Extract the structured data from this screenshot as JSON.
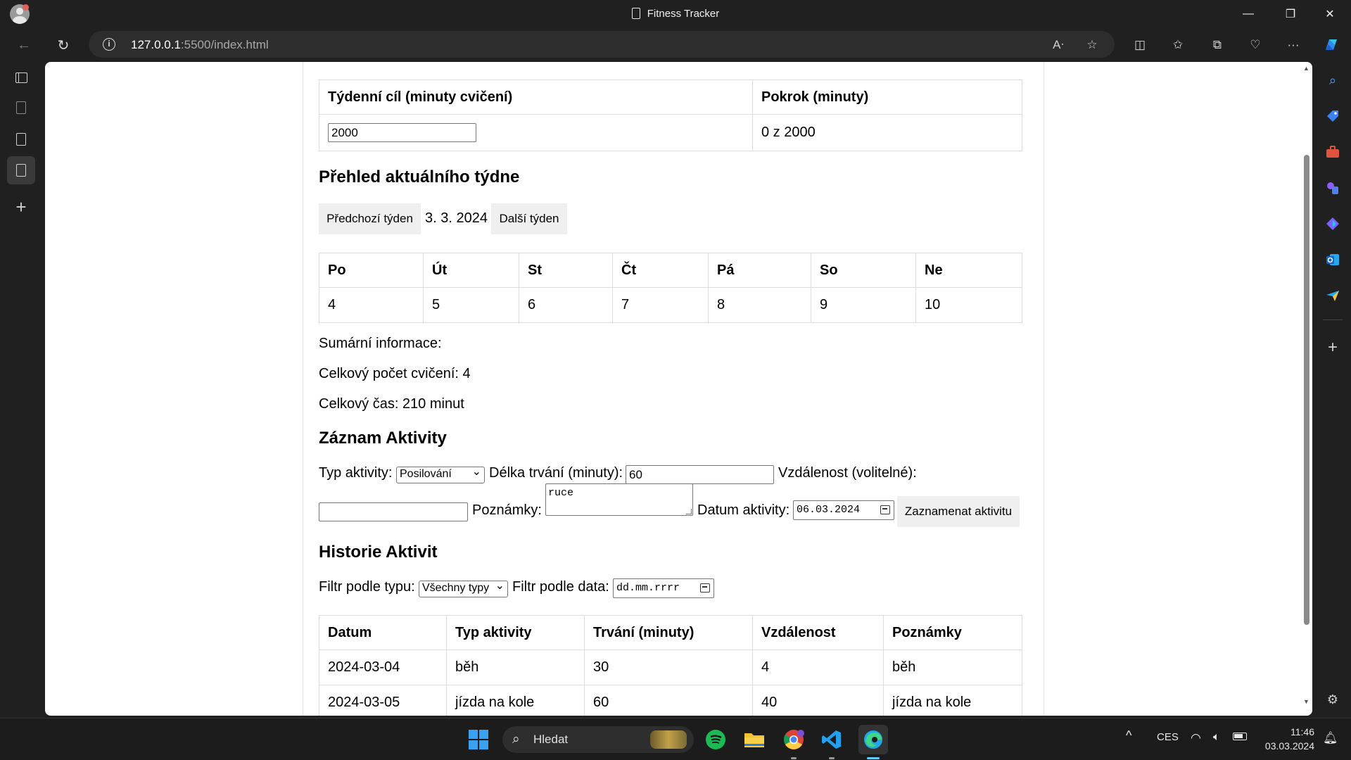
{
  "window": {
    "title": "Fitness Tracker"
  },
  "address": {
    "host": "127.0.0.1",
    "path": ":5500/index.html"
  },
  "goal": {
    "headers": [
      "Týdenní cíl (minuty cvičení)",
      "Pokrok (minuty)"
    ],
    "input_value": "2000",
    "progress_text": "0 z 2000"
  },
  "week": {
    "heading": "Přehled aktuálního týdne",
    "prev_label": "Předchozí týden",
    "date_label": "3. 3. 2024",
    "next_label": "Další týden",
    "days": [
      "Po",
      "Út",
      "St",
      "Čt",
      "Pá",
      "So",
      "Ne"
    ],
    "dates": [
      "4",
      "5",
      "6",
      "7",
      "8",
      "9",
      "10"
    ]
  },
  "summary": {
    "title": "Sumární informace:",
    "count_text": "Celkový počet cvičení: 4",
    "time_text": "Celkový čas: 210 minut"
  },
  "record": {
    "heading": "Záznam Aktivity",
    "type_label": "Typ aktivity:",
    "type_value": "Posilování",
    "duration_label": "Délka trvání (minuty):",
    "duration_value": "60",
    "distance_label": "Vzdálenost (volitelné):",
    "distance_value": "",
    "notes_label": "Poznámky:",
    "notes_value": "ruce",
    "date_label": "Datum aktivity:",
    "date_value": "06.03.2024",
    "submit_label": "Zaznamenat aktivitu"
  },
  "history": {
    "heading": "Historie Aktivit",
    "filter_type_label": "Filtr podle typu:",
    "filter_type_value": "Všechny typy",
    "filter_date_label": "Filtr podle data:",
    "filter_date_placeholder": "dd.mm.rrrr",
    "columns": [
      "Datum",
      "Typ aktivity",
      "Trvání (minuty)",
      "Vzdálenost",
      "Poznámky"
    ],
    "rows": [
      [
        "2024-03-04",
        "běh",
        "30",
        "4",
        "běh"
      ],
      [
        "2024-03-05",
        "jízda na kole",
        "60",
        "40",
        "jízda na kole"
      ]
    ]
  },
  "taskbar": {
    "search_label": "Hledat",
    "language": "CES",
    "time": "11:46",
    "date": "03.03.2024"
  },
  "icons": {
    "accent": "#0078d4",
    "spotify": "#1db954",
    "folder": "#f2c230"
  }
}
